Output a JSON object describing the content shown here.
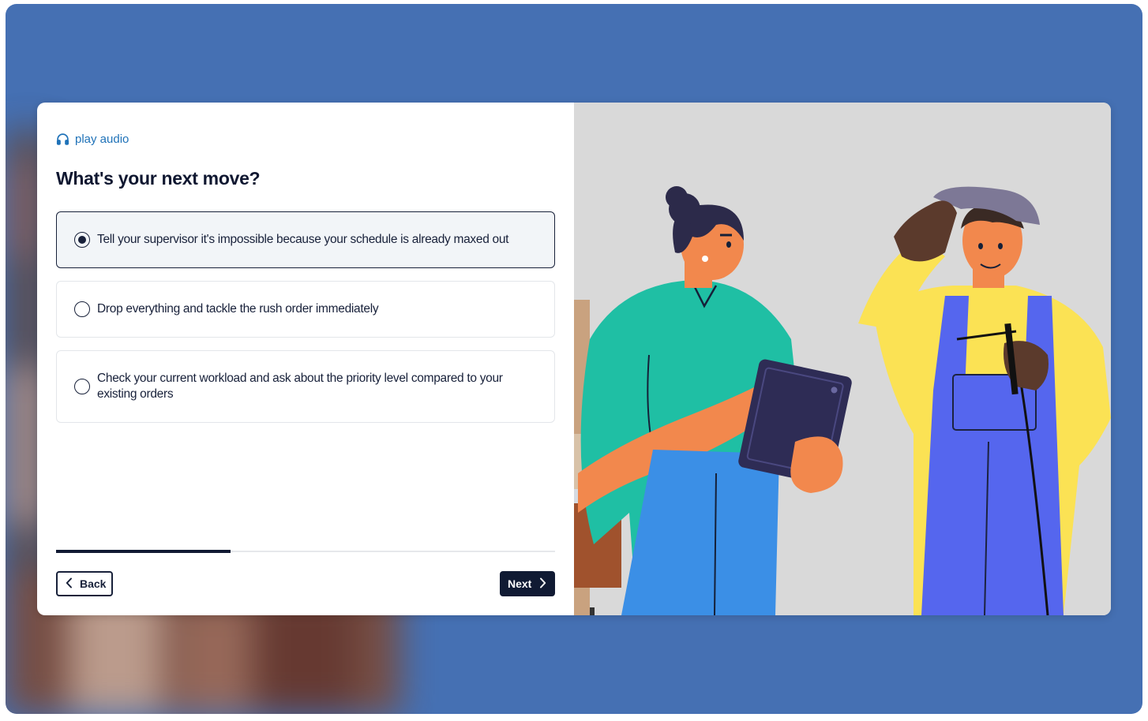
{
  "header": {
    "play_audio_label": "play audio",
    "icon": "headphones-icon"
  },
  "question": {
    "title": "What's your next move?"
  },
  "options": [
    {
      "label": "Tell your supervisor it's impossible because your schedule is already maxed out",
      "selected": true
    },
    {
      "label": "Drop everything and tackle the rush order immediately",
      "selected": false
    },
    {
      "label": "Check your current workload and ask about the priority level compared to your existing orders",
      "selected": false
    }
  ],
  "progress": {
    "fraction": 0.35
  },
  "navigation": {
    "back_label": "Back",
    "next_label": "Next",
    "back_icon": "chevron-left-icon",
    "next_icon": "chevron-right-icon"
  },
  "colors": {
    "page_background": "#4570b3",
    "text_dark": "#18213a",
    "link_blue": "#1f72b8",
    "selected_option_bg": "#f2f5f8",
    "next_button_bg": "#101a33"
  },
  "illustration": {
    "description_icon": "workers-illustration"
  }
}
